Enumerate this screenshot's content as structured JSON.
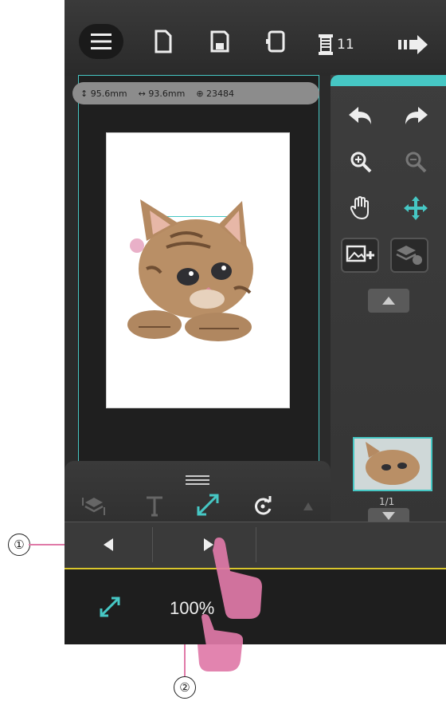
{
  "toolbar": {
    "menu_icon": "hamburger-icon",
    "new_icon": "new-file-icon",
    "save_icon": "save-icon",
    "hoop_icon": "hoop-icon",
    "thread_count_icon": "thread-spool-icon",
    "thread_count": "11",
    "next_icon": "forward-icon"
  },
  "stitch_info": {
    "height": "95.6mm",
    "width": "93.6mm",
    "stitches": "23484"
  },
  "right_panel": {
    "undo_icon": "undo-icon",
    "redo_icon": "redo-icon",
    "zoom_in_icon": "zoom-in-icon",
    "zoom_out_icon": "zoom-out-icon",
    "pan_icon": "hand-icon",
    "move_icon": "move-icon",
    "add_image_icon": "add-image-icon",
    "layers_icon": "layers-icon",
    "thumbnail_page": "1/1"
  },
  "bottom_tools": {
    "handle_icon": "drag-handle-icon",
    "order_icon": "layer-order-icon",
    "text_icon": "text-icon",
    "resize_icon": "resize-icon",
    "rotate_icon": "rotate-icon"
  },
  "zoom": {
    "value": "100%"
  },
  "callouts": {
    "one": "①",
    "two": "②"
  },
  "colors": {
    "accent": "#46c7c4",
    "highlight": "#d9c62c",
    "finger": "#e07aa8"
  }
}
